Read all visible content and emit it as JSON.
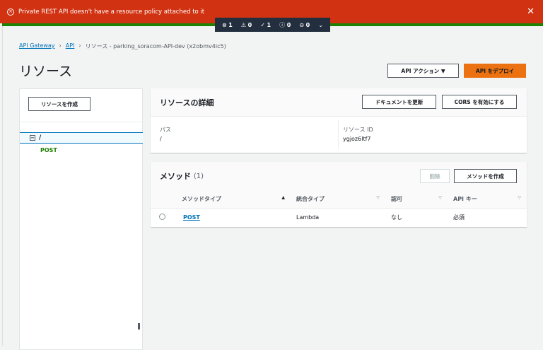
{
  "banner": {
    "message": "Private REST API doesn't have a resource policy attached to it",
    "icon": "error-circle-icon",
    "color": "#d13212"
  },
  "toolbar": {
    "errors": "1",
    "warnings": "0",
    "success": "1",
    "info": "0",
    "pending": "0"
  },
  "breadcrumb": {
    "items": [
      "API Gateway",
      "API",
      "リソース - parking_soracom-API-dev (x2obmv4ic5)"
    ]
  },
  "page": {
    "title": "リソース",
    "api_actions": "API アクション ▼",
    "deploy": "API をデプロイ",
    "accent": "#ec7211"
  },
  "left": {
    "create_resource": "リソースを作成",
    "tree": [
      {
        "label": "/",
        "methods": [
          "POST"
        ]
      }
    ]
  },
  "details": {
    "title": "リソースの詳細",
    "update_docs": "ドキュメントを更新",
    "enable_cors": "CORS を有効にする",
    "path_label": "パス",
    "path": "/",
    "id_label": "リソース ID",
    "id": "ygjoz6ltf7"
  },
  "methods": {
    "title": "メソッド",
    "count": "(1)",
    "delete": "削除",
    "create": "メソッドを作成",
    "columns": [
      "メソッドタイプ",
      "統合タイプ",
      "認可",
      "API キー"
    ],
    "rows": [
      [
        "POST",
        "Lambda",
        "なし",
        "必須"
      ]
    ]
  }
}
